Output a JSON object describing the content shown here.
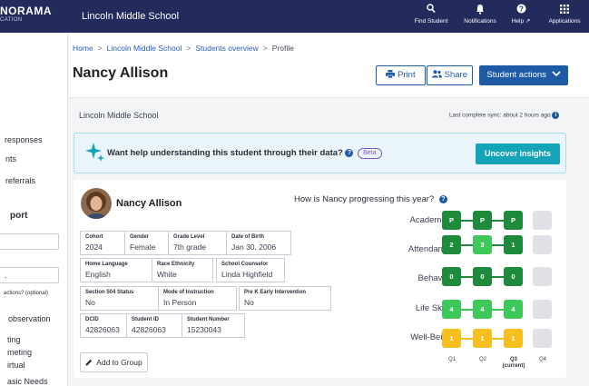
{
  "topbar": {
    "brand_line1": "NORAMA",
    "brand_line2": "CATION",
    "school": "Lincoln Middle School",
    "nav": [
      {
        "label": "Find Student",
        "icon": "search-icon"
      },
      {
        "label": "Notifications",
        "icon": "bell-icon"
      },
      {
        "label": "Help ↗",
        "icon": "help-icon"
      },
      {
        "label": "Applications",
        "icon": "grid-icon"
      }
    ]
  },
  "leftnav": {
    "items": [
      "responses",
      "nts",
      "referrals",
      "port",
      ".",
      "actions? (optional)",
      "observation",
      "ting",
      "meting",
      "irtual",
      "asic Needs"
    ]
  },
  "header": {
    "breadcrumb": [
      "Home",
      "Lincoln Middle School",
      "Students overview",
      "Profile"
    ],
    "title": "Nancy Allison",
    "print_label": "Print",
    "share_label": "Share",
    "actions_label": "Student actions"
  },
  "subheader": {
    "school": "Lincoln Middle School",
    "sync": "Last complete sync: about 2 hours ago"
  },
  "banner": {
    "question": "Want help understanding this student through their data?",
    "beta": "Beta",
    "button": "Uncover insights"
  },
  "student": {
    "name": "Nancy Allison",
    "fields": {
      "cohort": {
        "label": "Cohort",
        "value": "2024"
      },
      "gender": {
        "label": "Gender",
        "value": "Female"
      },
      "grade": {
        "label": "Grade Level",
        "value": "7th grade"
      },
      "dob": {
        "label": "Date of Birth",
        "value": "Jan 30, 2006"
      },
      "language": {
        "label": "Home Language",
        "value": "English"
      },
      "race": {
        "label": "Race Ethnicity",
        "value": "White"
      },
      "counselor": {
        "label": "School Counselor",
        "value": "Linda Highfield"
      },
      "s504": {
        "label": "Section 504 Status",
        "value": "No"
      },
      "instruction": {
        "label": "Mode of Instruction",
        "value": "In Person"
      },
      "prek": {
        "label": "Pre K Early Intervention",
        "value": "No"
      },
      "dcid": {
        "label": "DCID",
        "value": "42826063"
      },
      "studentid": {
        "label": "Student ID",
        "value": "42826063"
      },
      "studentnum": {
        "label": "Student Number",
        "value": "15230043"
      }
    },
    "add_group": "Add to Group"
  },
  "progress": {
    "title": "How is Nancy progressing this year?",
    "quarters": [
      "Q1",
      "Q2",
      "Q3",
      "Q4"
    ],
    "current_label": "(current)",
    "colors": {
      "dark": "#1e8a3c",
      "light": "#3fc85a",
      "yellow": "#f7bf1e",
      "empty": "#dfe1e6"
    },
    "rows": [
      {
        "label": "Academics",
        "cells": [
          {
            "v": "P",
            "c": "dark"
          },
          {
            "v": "P",
            "c": "dark"
          },
          {
            "v": "P",
            "c": "dark"
          },
          {
            "v": "",
            "c": "empty"
          }
        ]
      },
      {
        "label": "Attendance",
        "cells": [
          {
            "v": "2",
            "c": "dark"
          },
          {
            "v": "3",
            "c": "light"
          },
          {
            "v": "1",
            "c": "dark"
          },
          {
            "v": "",
            "c": "empty"
          }
        ]
      },
      {
        "label": "Behavior",
        "cells": [
          {
            "v": "0",
            "c": "dark"
          },
          {
            "v": "0",
            "c": "dark"
          },
          {
            "v": "0",
            "c": "dark"
          },
          {
            "v": "",
            "c": "empty"
          }
        ]
      },
      {
        "label": "Life Skills",
        "cells": [
          {
            "v": "4",
            "c": "light"
          },
          {
            "v": "4",
            "c": "light"
          },
          {
            "v": "4",
            "c": "light"
          },
          {
            "v": "",
            "c": "empty"
          }
        ]
      },
      {
        "label": "Well-Being",
        "cells": [
          {
            "v": "1",
            "c": "yellow"
          },
          {
            "v": "1",
            "c": "yellow"
          },
          {
            "v": "1",
            "c": "yellow"
          },
          {
            "v": "",
            "c": "empty"
          }
        ]
      }
    ]
  }
}
